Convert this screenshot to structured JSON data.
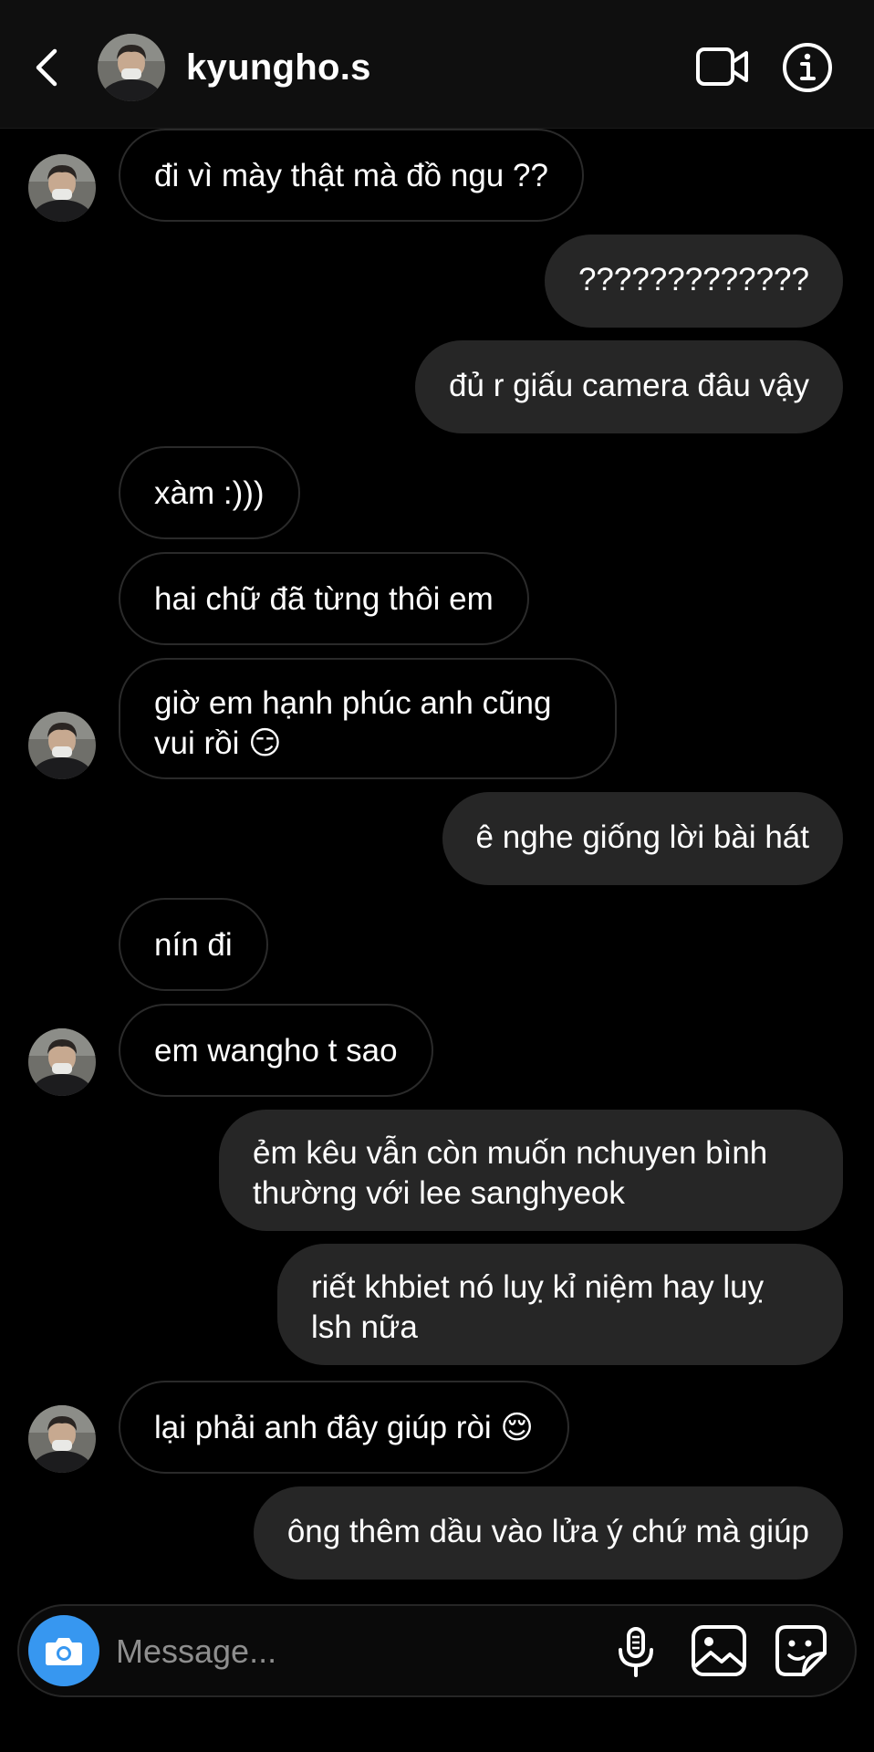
{
  "header": {
    "username": "kyungho.s",
    "back_icon": "chevron-left-icon",
    "video_icon": "video-call-icon",
    "info_icon": "info-icon"
  },
  "messages": [
    {
      "side": "received",
      "text": "đi vì mày thật mà đồ ngu ??",
      "avatar": true
    },
    {
      "side": "sent",
      "text": "?????????????"
    },
    {
      "side": "sent",
      "text": "đủ r giấu camera đâu vậy"
    },
    {
      "side": "received",
      "text": "xàm :)))"
    },
    {
      "side": "received",
      "text": "hai chữ đã từng thôi em"
    },
    {
      "side": "received",
      "text": "giờ em hạnh phúc anh cũng vui rồi 😏",
      "avatar": true
    },
    {
      "side": "sent",
      "text": "ê nghe giống lời bài hát"
    },
    {
      "side": "received",
      "text": "nín đi"
    },
    {
      "side": "received",
      "text": "em wangho t sao",
      "avatar": true
    },
    {
      "side": "sent",
      "text": "ẻm kêu vẫn còn muốn nchuyen bình thường với lee sanghyeok"
    },
    {
      "side": "sent",
      "text": "riết khbiet nó luỵ kỉ niệm hay luỵ lsh nữa"
    },
    {
      "side": "received",
      "text": "lại phải anh đây giúp ròi 😌",
      "avatar": true
    },
    {
      "side": "sent",
      "text": "ông thêm dầu vào lửa ý chứ mà giúp"
    }
  ],
  "composer": {
    "placeholder": "Message...",
    "camera_icon": "camera-icon",
    "mic_icon": "microphone-icon",
    "gallery_icon": "gallery-icon",
    "sticker_icon": "sticker-icon"
  },
  "colors": {
    "background": "#000000",
    "sent_bubble": "#262626",
    "received_border": "#2a2a2a",
    "camera_button": "#3797f0"
  }
}
